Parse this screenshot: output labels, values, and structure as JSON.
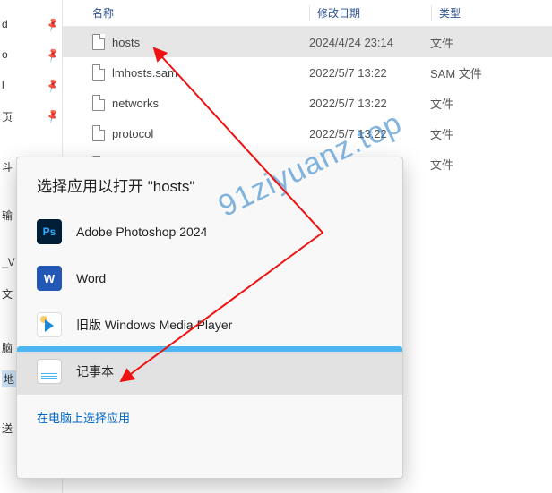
{
  "columns": {
    "name": "名称",
    "date": "修改日期",
    "type": "类型"
  },
  "files": [
    {
      "name": "hosts",
      "date": "2024/4/24 23:14",
      "type": "文件",
      "selected": true
    },
    {
      "name": "lmhosts.sam",
      "date": "2022/5/7 13:22",
      "type": "SAM 文件",
      "selected": false
    },
    {
      "name": "networks",
      "date": "2022/5/7 13:22",
      "type": "文件",
      "selected": false
    },
    {
      "name": "protocol",
      "date": "2022/5/7 13:22",
      "type": "文件",
      "selected": false
    },
    {
      "name": "",
      "date": "",
      "type": "文件",
      "selected": false
    }
  ],
  "dialog": {
    "title": "选择应用以打开 \"hosts\"",
    "apps": [
      {
        "label": "Adobe Photoshop 2024",
        "icon": "ps",
        "selected": false
      },
      {
        "label": "Word",
        "icon": "word",
        "selected": false
      },
      {
        "label": "旧版 Windows Media Player",
        "icon": "wmp",
        "selected": false
      },
      {
        "label": "记事本",
        "icon": "notepad",
        "selected": true
      }
    ],
    "more": "在电脑上选择应用"
  },
  "sidebar_fragments": [
    "d",
    "o",
    "l",
    "页",
    "斗",
    "输",
    "_V",
    "文",
    "脑",
    "地",
    "送"
  ],
  "watermark": "91ziyuanz.top"
}
